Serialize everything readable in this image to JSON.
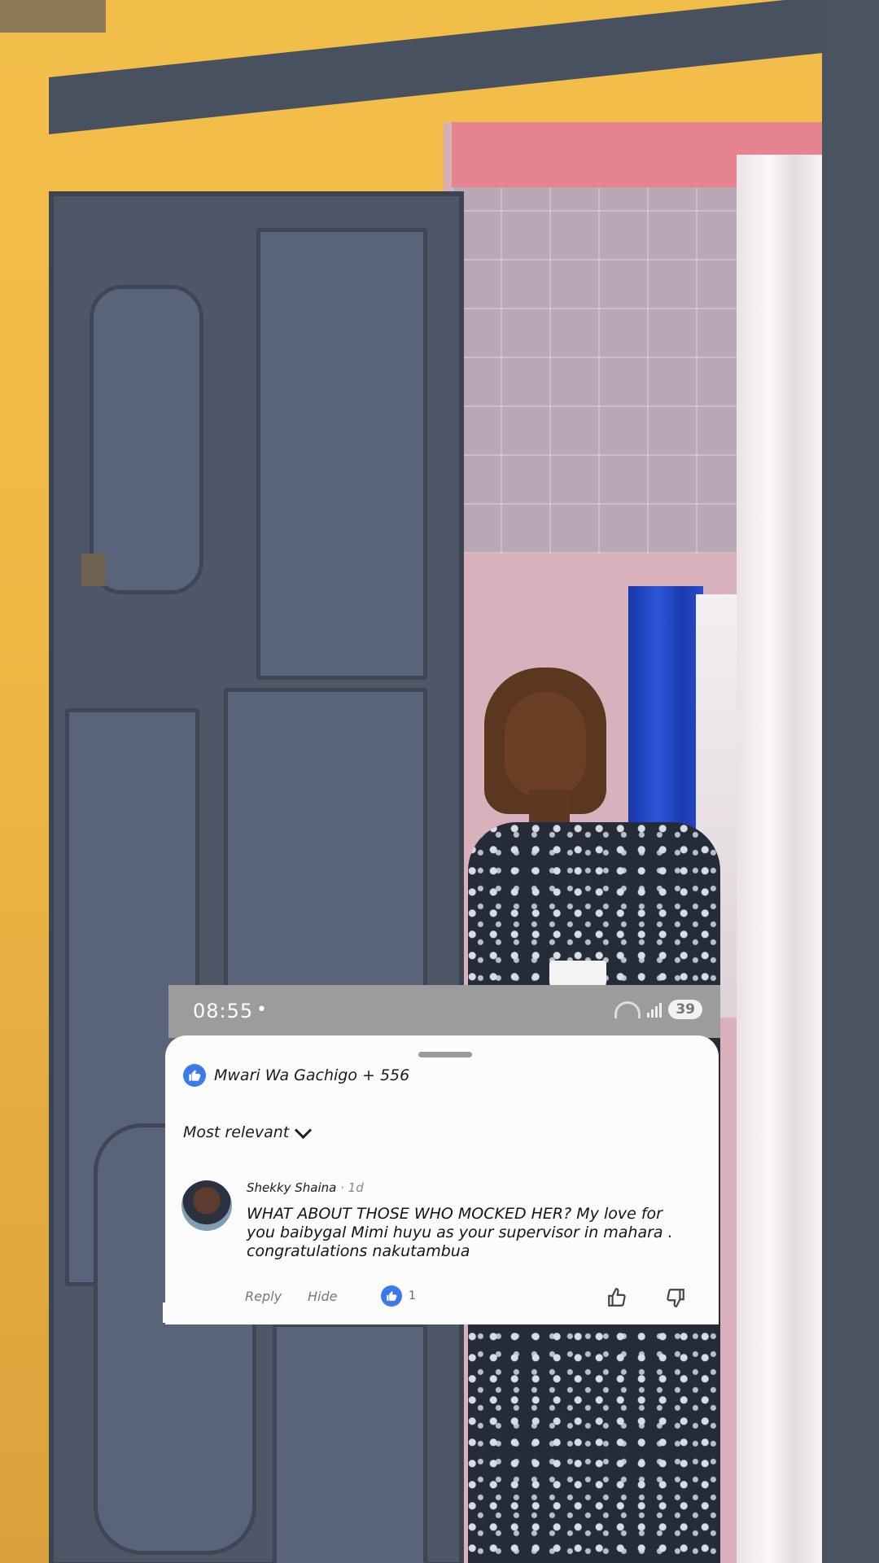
{
  "status_bar": {
    "time": "08:55",
    "dot": "•",
    "battery": "39"
  },
  "sheet": {
    "reactions_label": "Mwari Wa Gachigo + 556",
    "sort_label": "Most relevant",
    "comment": {
      "author": "Shekky Shaina",
      "time": " · 1d",
      "text": "WHAT ABOUT THOSE WHO MOCKED HER? My love for you baibygal Mimi huyu as your supervisor in mahara . congratulations nakutambua",
      "reply_label": "Reply",
      "hide_label": "Hide",
      "like_count": "1"
    }
  },
  "icons": {
    "like_badge": "thumbs-up-icon",
    "sort": "chevron-down-icon",
    "like": "thumbs-up-outline-icon",
    "dislike": "thumbs-down-outline-icon"
  },
  "colors": {
    "accent": "#3b79ec",
    "wall": "#f0b845",
    "door": "#4d5767"
  }
}
